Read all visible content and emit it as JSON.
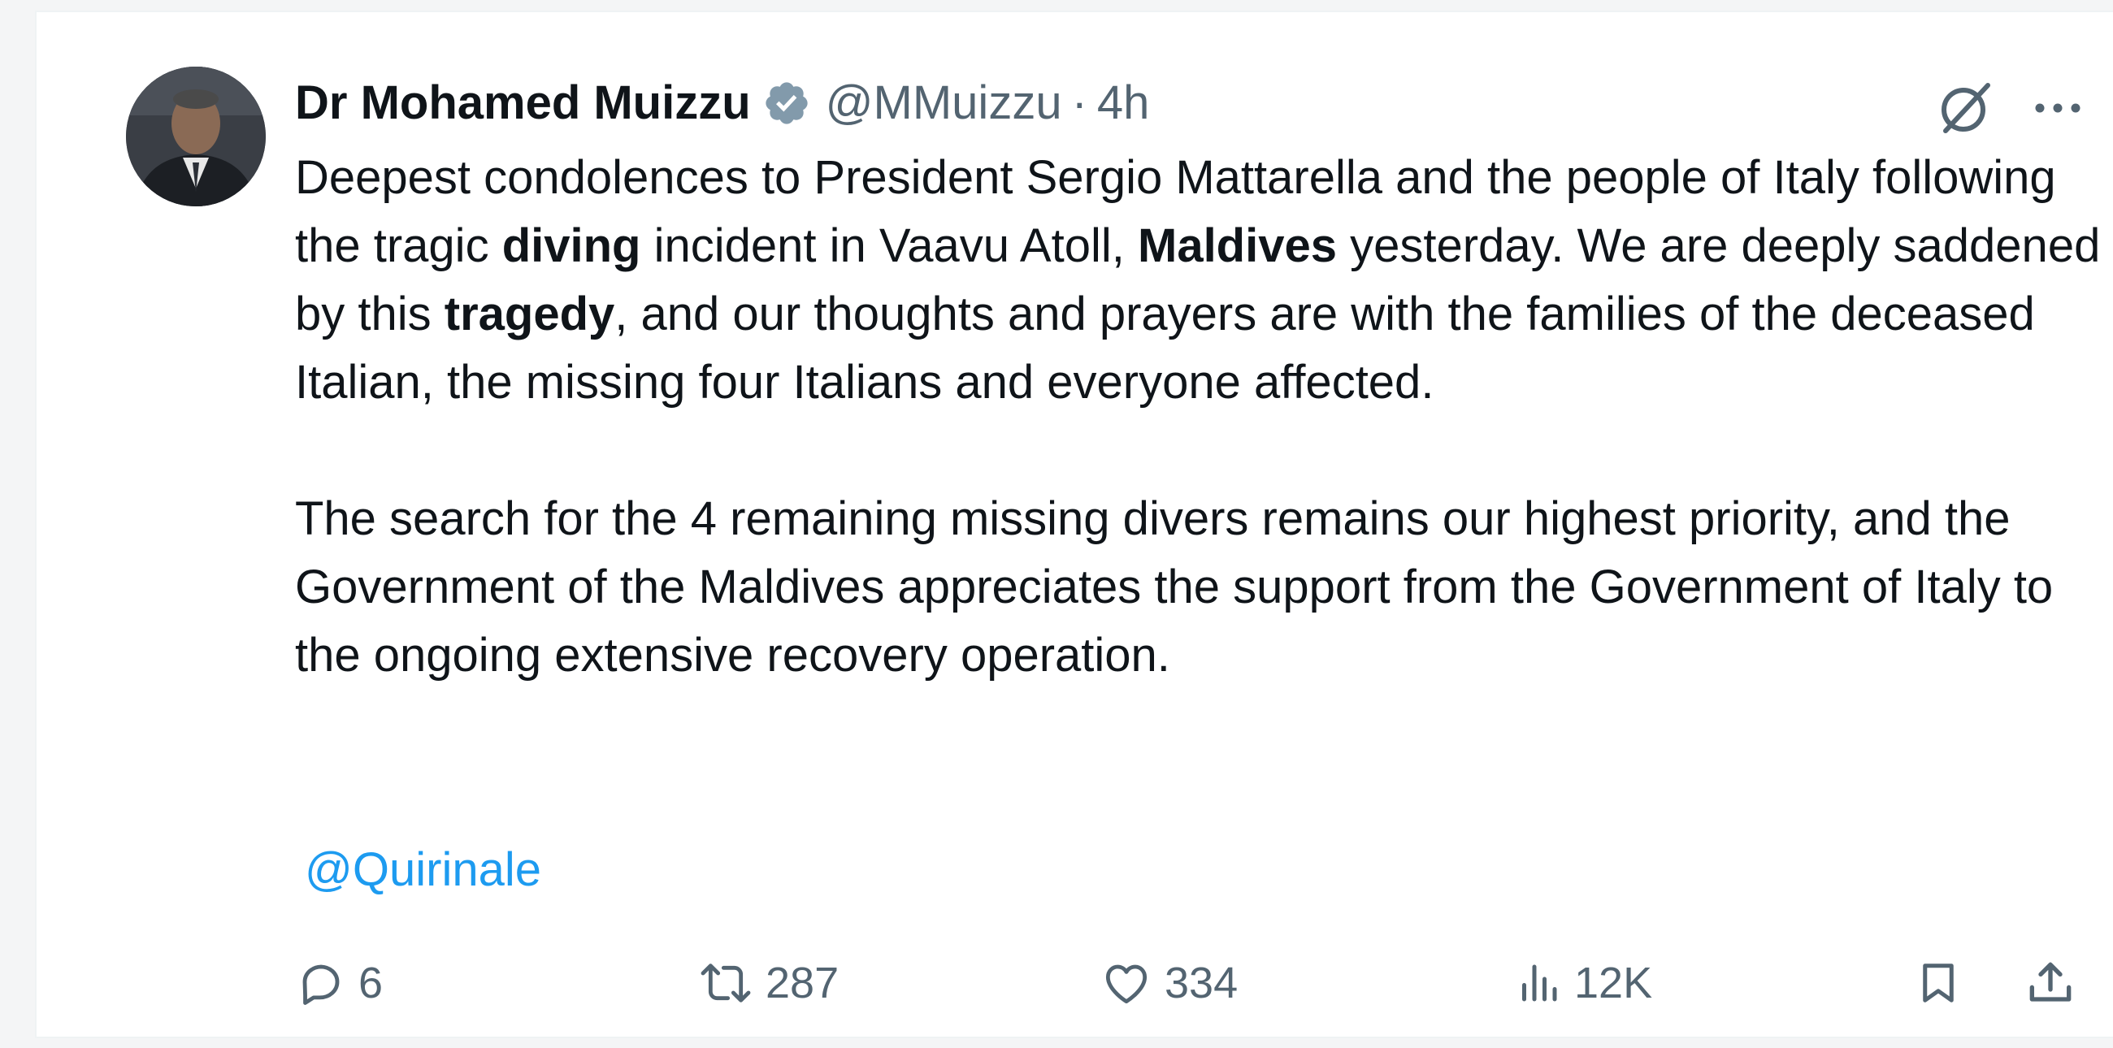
{
  "tweet": {
    "author": {
      "display_name": "Dr Mohamed Muizzu",
      "handle": "@MMuizzu",
      "separator": "·",
      "time": "4h",
      "verified_icon": "verified-badge-icon",
      "avatar": "avatar"
    },
    "text": {
      "p1_a": "Deepest condolences to President Sergio Mattarella and the people of Italy following the tragic ",
      "p1_b1": "diving",
      "p1_c": " incident in Vaavu Atoll, ",
      "p1_b2": "Maldives",
      "p1_d": " yesterday. We are deeply saddened by this ",
      "p1_b3": "tragedy",
      "p1_e": ", and our thoughts and prayers are with the families of the deceased Italian, the missing four Italians and everyone affected.",
      "p2": "The search for the 4 remaining missing divers remains our highest priority, and the Government of the Maldives appreciates the support from the Government of Italy to the ongoing extensive recovery operation."
    },
    "mention": "@Quirinale",
    "actions": {
      "replies": "6",
      "reposts": "287",
      "likes": "334",
      "views": "12K"
    },
    "colors": {
      "text": "#0f1419",
      "muted": "#536471",
      "link": "#1d9bf0"
    }
  }
}
